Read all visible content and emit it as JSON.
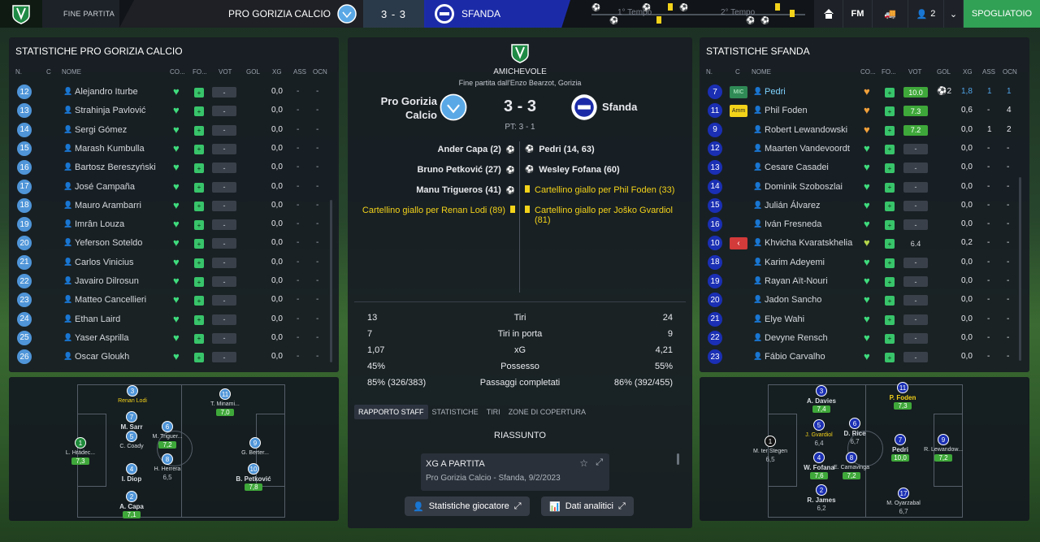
{
  "topbar": {
    "status": "FINE PARTITA",
    "home_team": "PRO GORIZIA CALCIO",
    "score": "3 - 3",
    "away_team": "SFANDA",
    "half1": "1° Tempo",
    "half2": "2° Tempo",
    "fm_label": "FM",
    "players_count": "2",
    "spogliatoio": "SPOGLIATOIO"
  },
  "left": {
    "title": "STATISTICHE PRO GORIZIA CALCIO",
    "headers": {
      "n": "N.",
      "c": "C",
      "name": "NOME",
      "co": "CO...",
      "fo": "FO...",
      "vot": "VOT",
      "gol": "GOL",
      "xg": "XG",
      "ass": "ASS",
      "ocn": "OCN"
    },
    "rows": [
      {
        "num": "12",
        "name": "Alejandro Iturbe",
        "vote": "-",
        "gol": "",
        "xg": "0,0",
        "ass": "-",
        "ocn": "-"
      },
      {
        "num": "13",
        "name": "Strahinja Pavlović",
        "vote": "-",
        "gol": "",
        "xg": "0,0",
        "ass": "-",
        "ocn": "-"
      },
      {
        "num": "14",
        "name": "Sergi Gómez",
        "vote": "-",
        "gol": "",
        "xg": "0,0",
        "ass": "-",
        "ocn": "-"
      },
      {
        "num": "15",
        "name": "Marash Kumbulla",
        "vote": "-",
        "gol": "",
        "xg": "0,0",
        "ass": "-",
        "ocn": "-"
      },
      {
        "num": "16",
        "name": "Bartosz Bereszyński",
        "vote": "-",
        "gol": "",
        "xg": "0,0",
        "ass": "-",
        "ocn": "-"
      },
      {
        "num": "17",
        "name": "José Campaña",
        "vote": "-",
        "gol": "",
        "xg": "0,0",
        "ass": "-",
        "ocn": "-"
      },
      {
        "num": "18",
        "name": "Mauro Arambarri",
        "vote": "-",
        "gol": "",
        "xg": "0,0",
        "ass": "-",
        "ocn": "-"
      },
      {
        "num": "19",
        "name": "Imrân Louza",
        "vote": "-",
        "gol": "",
        "xg": "0,0",
        "ass": "-",
        "ocn": "-"
      },
      {
        "num": "20",
        "name": "Yeferson Soteldo",
        "vote": "-",
        "gol": "",
        "xg": "0,0",
        "ass": "-",
        "ocn": "-"
      },
      {
        "num": "21",
        "name": "Carlos Vinicius",
        "vote": "-",
        "gol": "",
        "xg": "0,0",
        "ass": "-",
        "ocn": "-"
      },
      {
        "num": "22",
        "name": "Javairo Dilrosun",
        "vote": "-",
        "gol": "",
        "xg": "0,0",
        "ass": "-",
        "ocn": "-"
      },
      {
        "num": "23",
        "name": "Matteo Cancellieri",
        "vote": "-",
        "gol": "",
        "xg": "0,0",
        "ass": "-",
        "ocn": "-"
      },
      {
        "num": "24",
        "name": "Ethan Laird",
        "vote": "-",
        "gol": "",
        "xg": "0,0",
        "ass": "-",
        "ocn": "-"
      },
      {
        "num": "25",
        "name": "Yaser Asprilla",
        "vote": "-",
        "gol": "",
        "xg": "0,0",
        "ass": "-",
        "ocn": "-"
      },
      {
        "num": "26",
        "name": "Oscar Gloukh",
        "vote": "-",
        "gol": "",
        "xg": "0,0",
        "ass": "-",
        "ocn": "-"
      }
    ],
    "pitch": [
      {
        "num": "1",
        "name": "L. Hrádec...",
        "rating": "7,3"
      },
      {
        "num": "3",
        "name": "Renan Lodi",
        "rating": ""
      },
      {
        "num": "7",
        "name": "M. Sarr",
        "rating": "6,8"
      },
      {
        "num": "5",
        "name": "C. Coady",
        "rating": ""
      },
      {
        "num": "4",
        "name": "I. Diop",
        "rating": ""
      },
      {
        "num": "2",
        "name": "A. Capa",
        "rating": "7,1"
      },
      {
        "num": "6",
        "name": "M. Triguer...",
        "rating": "7,2"
      },
      {
        "num": "8",
        "name": "H. Herrera",
        "rating": "6,5"
      },
      {
        "num": "11",
        "name": "T. Minami...",
        "rating": "7,0"
      },
      {
        "num": "9",
        "name": "G. Berter...",
        "rating": ""
      },
      {
        "num": "10",
        "name": "B. Petković",
        "rating": "7,8"
      }
    ]
  },
  "center": {
    "competition": "AMICHEVOLE",
    "subtitle": "Fine partita dall'Enzo Bearzot, Gorizia",
    "home": "Pro Gorizia Calcio",
    "away": "Sfanda",
    "score": "3 - 3",
    "ht": "PT: 3 - 1",
    "events_home": [
      "Ander Capa (2)",
      "Bruno Petković (27)",
      "Manu Trigueros (41)",
      "Cartellino giallo per Renan Lodi (89)"
    ],
    "events_away": [
      "Pedri (14, 63)",
      "Wesley Fofana (60)",
      "Cartellino giallo per Phil Foden (33)",
      "Cartellino giallo per Joško Gvardiol (81)"
    ],
    "stats": [
      {
        "h": "13",
        "label": "Tiri",
        "a": "24"
      },
      {
        "h": "7",
        "label": "Tiri in porta",
        "a": "9"
      },
      {
        "h": "1,07",
        "label": "xG",
        "a": "4,21"
      },
      {
        "h": "45%",
        "label": "Possesso",
        "a": "55%"
      },
      {
        "h": "85% (326/383)",
        "label": "Passaggi completati",
        "a": "86% (392/455)"
      }
    ],
    "tabs": [
      "RAPPORTO STAFF",
      "STATISTICHE",
      "TIRI",
      "ZONE DI COPERTURA"
    ],
    "riassunto": "RIASSUNTO",
    "card_title": "XG A PARTITA",
    "card_sub": "Pro Gorizia Calcio - Sfanda, 9/2/2023",
    "btn_players": "Statistiche giocatore",
    "btn_data": "Dati analitici"
  },
  "right": {
    "title": "STATISTICHE SFANDA",
    "headers": {
      "n": "N.",
      "c": "C",
      "name": "NOME",
      "co": "CO...",
      "fo": "FO...",
      "vot": "VOT",
      "gol": "GOL",
      "xg": "XG",
      "ass": "ASS",
      "ocn": "OCN"
    },
    "rows": [
      {
        "num": "7",
        "badge": "MIC",
        "name": "Pedri",
        "vote": "10.0",
        "gol": "2",
        "xg": "1,8",
        "ass": "1",
        "ocn": "1",
        "heart": "o"
      },
      {
        "num": "11",
        "badge": "Amm",
        "name": "Phil Foden",
        "vote": "7.3",
        "gol": "",
        "xg": "0,6",
        "ass": "-",
        "ocn": "4",
        "heart": "o"
      },
      {
        "num": "9",
        "badge": "",
        "name": "Robert Lewandowski",
        "vote": "7.2",
        "gol": "",
        "xg": "0,0",
        "ass": "1",
        "ocn": "2",
        "heart": "o"
      },
      {
        "num": "12",
        "badge": "",
        "name": "Maarten Vandevoordt",
        "vote": "-",
        "gol": "",
        "xg": "0,0",
        "ass": "-",
        "ocn": "-",
        "heart": ""
      },
      {
        "num": "13",
        "badge": "",
        "name": "Cesare Casadei",
        "vote": "-",
        "gol": "",
        "xg": "0,0",
        "ass": "-",
        "ocn": "-",
        "heart": ""
      },
      {
        "num": "14",
        "badge": "",
        "name": "Dominik Szoboszlai",
        "vote": "-",
        "gol": "",
        "xg": "0,0",
        "ass": "-",
        "ocn": "-",
        "heart": ""
      },
      {
        "num": "15",
        "badge": "",
        "name": "Julián Álvarez",
        "vote": "-",
        "gol": "",
        "xg": "0,0",
        "ass": "-",
        "ocn": "-",
        "heart": ""
      },
      {
        "num": "16",
        "badge": "",
        "name": "Iván Fresneda",
        "vote": "-",
        "gol": "",
        "xg": "0,0",
        "ass": "-",
        "ocn": "-",
        "heart": ""
      },
      {
        "num": "10",
        "badge": "sub",
        "name": "Khvicha Kvaratskhelia",
        "vote": "6.4",
        "gol": "",
        "xg": "0,2",
        "ass": "-",
        "ocn": "-",
        "heart": "y"
      },
      {
        "num": "18",
        "badge": "",
        "name": "Karim Adeyemi",
        "vote": "-",
        "gol": "",
        "xg": "0,0",
        "ass": "-",
        "ocn": "-",
        "heart": ""
      },
      {
        "num": "19",
        "badge": "",
        "name": "Rayan Aït-Nouri",
        "vote": "-",
        "gol": "",
        "xg": "0,0",
        "ass": "-",
        "ocn": "-",
        "heart": ""
      },
      {
        "num": "20",
        "badge": "",
        "name": "Jadon Sancho",
        "vote": "-",
        "gol": "",
        "xg": "0,0",
        "ass": "-",
        "ocn": "-",
        "heart": ""
      },
      {
        "num": "21",
        "badge": "",
        "name": "Elye Wahi",
        "vote": "-",
        "gol": "",
        "xg": "0,0",
        "ass": "-",
        "ocn": "-",
        "heart": ""
      },
      {
        "num": "22",
        "badge": "",
        "name": "Devyne Rensch",
        "vote": "-",
        "gol": "",
        "xg": "0,0",
        "ass": "-",
        "ocn": "-",
        "heart": ""
      },
      {
        "num": "23",
        "badge": "",
        "name": "Fábio Carvalho",
        "vote": "-",
        "gol": "",
        "xg": "0,0",
        "ass": "-",
        "ocn": "-",
        "heart": ""
      }
    ],
    "pitch": [
      {
        "num": "1",
        "name": "M. ter Stegen",
        "rating": "6,5"
      },
      {
        "num": "3",
        "name": "A. Davies",
        "rating": "7,4"
      },
      {
        "num": "5",
        "name": "J. Gvardiol",
        "rating": "6,4"
      },
      {
        "num": "4",
        "name": "W. Fofana",
        "rating": "7,6"
      },
      {
        "num": "2",
        "name": "R. James",
        "rating": "6,2"
      },
      {
        "num": "6",
        "name": "D. Rice",
        "rating": "6,7"
      },
      {
        "num": "8",
        "name": "E. Camavinga",
        "rating": "7,2"
      },
      {
        "num": "11",
        "name": "P. Foden",
        "rating": "7,3"
      },
      {
        "num": "7",
        "name": "Pedri",
        "rating": "10,0"
      },
      {
        "num": "9",
        "name": "R. Lewandow...",
        "rating": "7,2"
      },
      {
        "num": "17",
        "name": "M. Oyarzabal",
        "rating": "6,7"
      }
    ]
  }
}
